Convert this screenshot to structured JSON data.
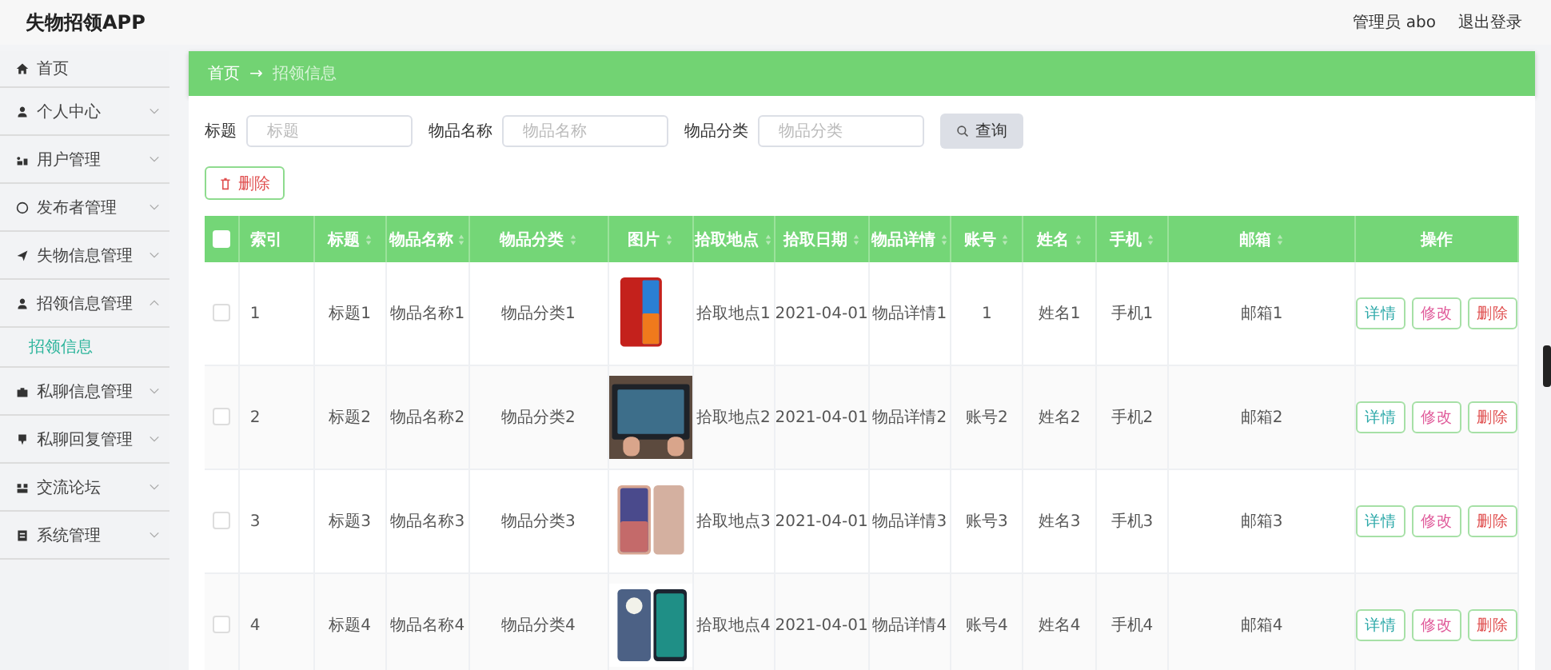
{
  "header": {
    "app_title": "失物招领APP",
    "user": "管理员 abo",
    "logout": "退出登录"
  },
  "sidebar": {
    "items": [
      {
        "label": "首页"
      },
      {
        "label": "个人中心",
        "expanded": false
      },
      {
        "label": "用户管理",
        "expanded": false
      },
      {
        "label": "发布者管理",
        "expanded": false
      },
      {
        "label": "失物信息管理",
        "expanded": false
      },
      {
        "label": "招领信息管理",
        "expanded": true,
        "children": [
          {
            "label": "招领信息",
            "selected": true
          }
        ]
      },
      {
        "label": "私聊信息管理",
        "expanded": false
      },
      {
        "label": "私聊回复管理",
        "expanded": false
      },
      {
        "label": "交流论坛",
        "expanded": false
      },
      {
        "label": "系统管理",
        "expanded": false
      }
    ]
  },
  "breadcrumb": {
    "home": "首页",
    "separator": "→",
    "current": "招领信息"
  },
  "search": {
    "fields": [
      {
        "label": "标题",
        "placeholder": "标题"
      },
      {
        "label": "物品名称",
        "placeholder": "物品名称"
      },
      {
        "label": "物品分类",
        "placeholder": "物品分类"
      }
    ],
    "button": "查询"
  },
  "delete_button": "删除",
  "table": {
    "select_all": {
      "checked": false
    },
    "columns": [
      {
        "label": "索引",
        "sortable": false
      },
      {
        "label": "标题",
        "sortable": true
      },
      {
        "label": "物品名称",
        "sortable": true
      },
      {
        "label": "物品分类",
        "sortable": true
      },
      {
        "label": "图片",
        "sortable": true
      },
      {
        "label": "拾取地点",
        "sortable": true
      },
      {
        "label": "拾取日期",
        "sortable": true
      },
      {
        "label": "物品详情",
        "sortable": true
      },
      {
        "label": "账号",
        "sortable": true
      },
      {
        "label": "姓名",
        "sortable": true
      },
      {
        "label": "手机",
        "sortable": true
      },
      {
        "label": "邮箱",
        "sortable": true
      },
      {
        "label": "操作",
        "sortable": false
      }
    ],
    "rows": [
      {
        "checked": false,
        "cells": [
          "1",
          "标题1",
          "物品名称1",
          "物品分类1"
        ],
        "cells_after": [
          "拾取地点1",
          "2021-04-01",
          "物品详情1",
          "1",
          "姓名1",
          "手机1",
          "邮箱1"
        ],
        "actions": [
          {
            "label": "详情",
            "kind": "detail"
          },
          {
            "label": "修改",
            "kind": "edit"
          },
          {
            "label": "删除",
            "kind": "delete"
          }
        ]
      },
      {
        "checked": false,
        "cells": [
          "2",
          "标题2",
          "物品名称2",
          "物品分类2"
        ],
        "cells_after": [
          "拾取地点2",
          "2021-04-01",
          "物品详情2",
          "账号2",
          "姓名2",
          "手机2",
          "邮箱2"
        ],
        "actions": [
          {
            "label": "详情",
            "kind": "detail"
          },
          {
            "label": "修改",
            "kind": "edit"
          },
          {
            "label": "删除",
            "kind": "delete"
          }
        ]
      },
      {
        "checked": false,
        "cells": [
          "3",
          "标题3",
          "物品名称3",
          "物品分类3"
        ],
        "cells_after": [
          "拾取地点3",
          "2021-04-01",
          "物品详情3",
          "账号3",
          "姓名3",
          "手机3",
          "邮箱3"
        ],
        "actions": [
          {
            "label": "详情",
            "kind": "detail"
          },
          {
            "label": "修改",
            "kind": "edit"
          },
          {
            "label": "删除",
            "kind": "delete"
          }
        ]
      },
      {
        "checked": false,
        "cells": [
          "4",
          "标题4",
          "物品名称4",
          "物品分类4"
        ],
        "cells_after": [
          "拾取地点4",
          "2021-04-01",
          "物品详情4",
          "账号4",
          "姓名4",
          "手机4",
          "邮箱4"
        ],
        "actions": [
          {
            "label": "详情",
            "kind": "detail"
          },
          {
            "label": "修改",
            "kind": "edit"
          },
          {
            "label": "删除",
            "kind": "delete"
          }
        ]
      }
    ]
  }
}
